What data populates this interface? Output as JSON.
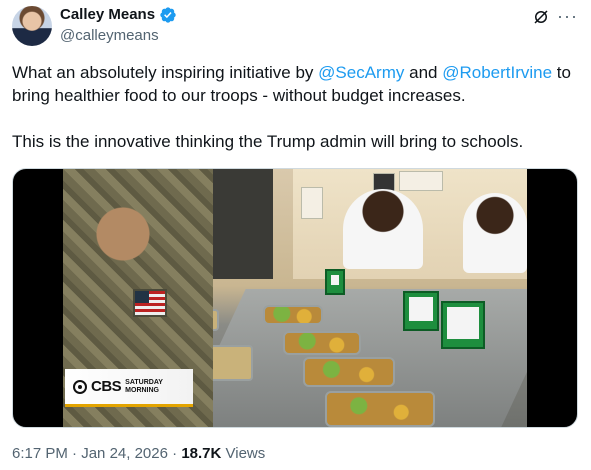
{
  "author": {
    "display_name": "Calley Means",
    "handle": "@calleymeans",
    "verified_icon": "verified-badge-icon",
    "verified_color": "#1d9bf0"
  },
  "header_icons": {
    "grok": "grok-icon",
    "more": "more-icon",
    "more_glyph": "···"
  },
  "tweet": {
    "line1_a": "What an absolutely inspiring initiative by ",
    "mention1": "@SecArmy",
    "line1_b": " and ",
    "mention2": "@RobertIrvine",
    "line1_c": " to bring healthier food to our troops - without budget increases.",
    "para2": "This is the innovative thinking the Trump admin will bring to schools."
  },
  "media": {
    "network_logo": "CBS",
    "program_line1": "SATURDAY",
    "program_line2": "MORNING"
  },
  "meta": {
    "time": "6:17 PM",
    "separator1": " · ",
    "date": "Jan 24, 2026",
    "separator2": " · ",
    "views_count": "18.7K",
    "views_label": " Views"
  },
  "colors": {
    "link": "#1d9bf0",
    "secondary_text": "#536471",
    "primary_text": "#0f1419"
  }
}
